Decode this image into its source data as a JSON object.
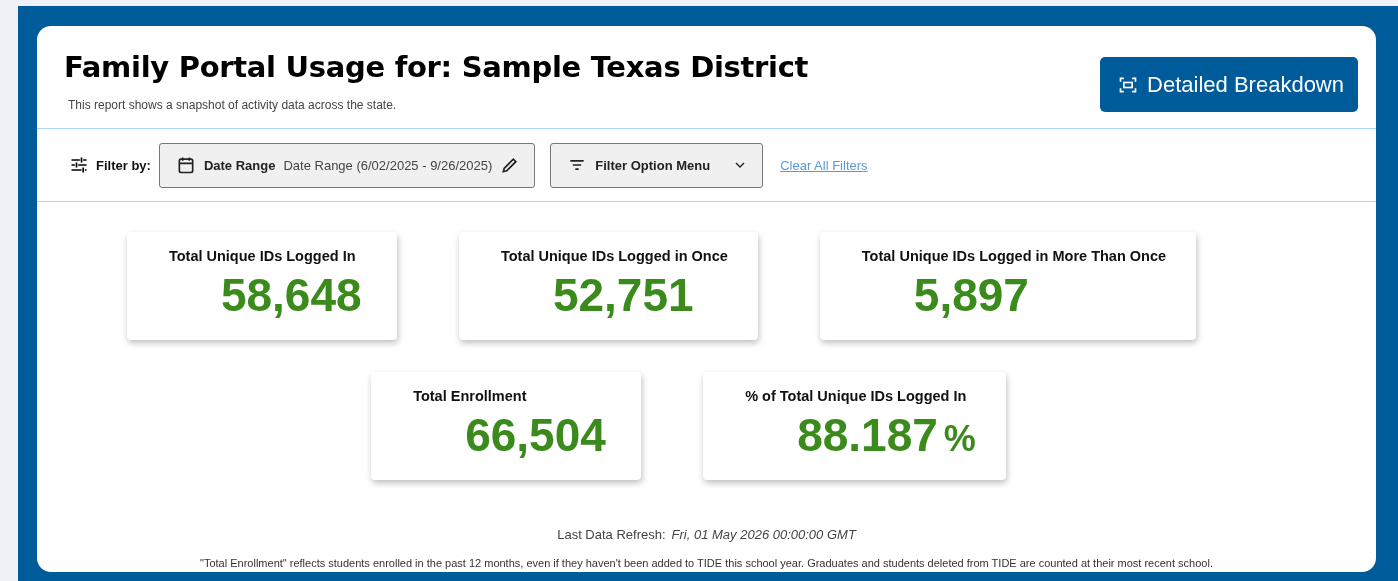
{
  "header": {
    "title": "Family Portal Usage for: Sample Texas District",
    "subtitle": "This report shows a snapshot of activity data across the state.",
    "action_button": "Detailed Breakdown"
  },
  "filters": {
    "label": "Filter by:",
    "date_range": {
      "label": "Date Range",
      "value": "Date Range (6/02/2025 - 9/26/2025)"
    },
    "option_menu": "Filter Option Menu",
    "clear_link": "Clear All Filters"
  },
  "stat_rows": [
    [
      {
        "title": "Total Unique IDs Logged In",
        "value": "58,648"
      },
      {
        "title": "Total Unique IDs Logged in Once",
        "value": "52,751"
      },
      {
        "title": "Total Unique IDs Logged in More Than Once",
        "value": "5,897"
      }
    ],
    [
      {
        "title": "Total Enrollment",
        "value": "66,504"
      },
      {
        "title": "% of Total Unique IDs Logged In",
        "value": "88.187",
        "unit": "%"
      }
    ]
  ],
  "refresh": {
    "label": "Last Data Refresh:",
    "value": "Fri, 01 May 2026 00:00:00 GMT"
  },
  "footnote": "\"Total Enrollment\" reflects students enrolled in the past 12 months, even if they haven't been added to TIDE this school year. Graduates and students deleted from TIDE are counted at their most recent school."
}
